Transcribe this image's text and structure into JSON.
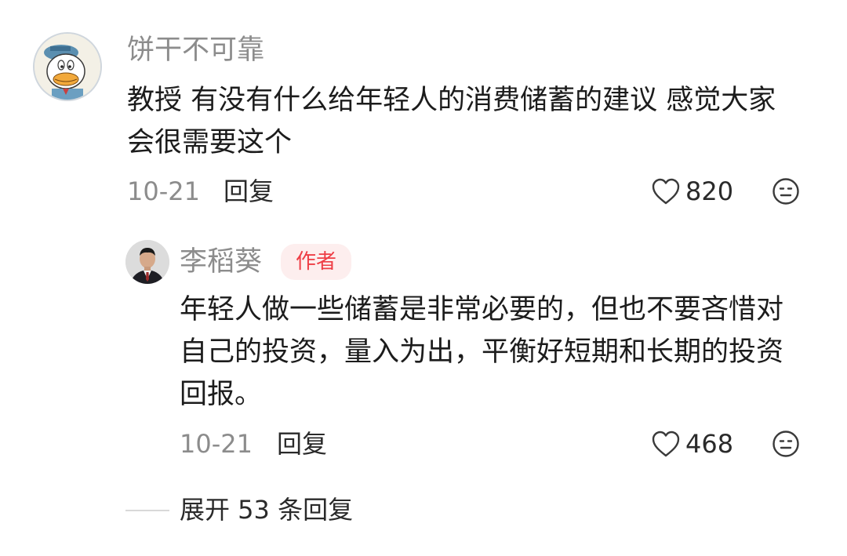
{
  "comment": {
    "username": "饼干不可靠",
    "text": "教授 有没有什么给年轻人的消费储蓄的建议 感觉大家会很需要这个",
    "date": "10-21",
    "reply_label": "回复",
    "likes": "820",
    "avatar_icon": "cartoon-duck-avatar",
    "like_icon": "heart-outline-icon",
    "emoji_icon": "neutral-face-icon"
  },
  "reply": {
    "username": "李稻葵",
    "badge": "作者",
    "badge_color": "#ee3d45",
    "text": "年轻人做一些储蓄是非常必要的，但也不要吝惜对自己的投资，量入为出，平衡好短期和长期的投资回报。",
    "date": "10-21",
    "reply_label": "回复",
    "likes": "468",
    "avatar_icon": "portrait-photo-avatar",
    "like_icon": "heart-outline-icon",
    "emoji_icon": "neutral-face-icon"
  },
  "expand": {
    "label": "展开 53 条回复"
  }
}
